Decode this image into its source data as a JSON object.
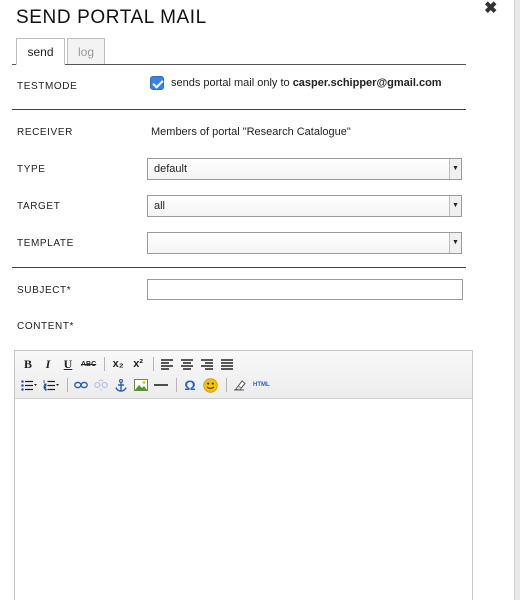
{
  "dialog": {
    "title": "SEND PORTAL MAIL",
    "close_symbol": "✖"
  },
  "tabs": [
    {
      "label": "send",
      "active": true
    },
    {
      "label": "log",
      "active": false
    }
  ],
  "testmode": {
    "label": "TESTMODE",
    "checked": true,
    "text_prefix": "sends portal mail only to",
    "email": "casper.schipper@gmail.com"
  },
  "receiver": {
    "label": "RECEIVER",
    "value": "Members of portal \"Research Catalogue\""
  },
  "type": {
    "label": "TYPE",
    "value": "default"
  },
  "target": {
    "label": "TARGET",
    "value": "all"
  },
  "template": {
    "label": "TEMPLATE",
    "value": ""
  },
  "subject": {
    "label": "SUBJECT*",
    "value": ""
  },
  "content": {
    "label": "CONTENT*"
  },
  "toolbar": {
    "bold": "B",
    "italic": "I",
    "underline": "U",
    "strike": "ABC",
    "subscript": "x₂",
    "superscript": "x²",
    "html": "HTML",
    "icons": [
      "bold-icon",
      "italic-icon",
      "underline-icon",
      "strikethrough-icon",
      "subscript-icon",
      "superscript-icon",
      "align-left-icon",
      "align-center-icon",
      "align-right-icon",
      "align-justify-icon",
      "bullet-list-icon",
      "numbered-list-icon",
      "link-icon",
      "unlink-icon",
      "anchor-icon",
      "image-icon",
      "horizontal-rule-icon",
      "special-char-icon",
      "emoticon-icon",
      "remove-format-icon",
      "html-source-icon"
    ]
  },
  "colors": {
    "checkbox": "#3b82e6",
    "emoticon": "#f4c20d",
    "link": "#2a62b8",
    "divider": "#444444"
  }
}
